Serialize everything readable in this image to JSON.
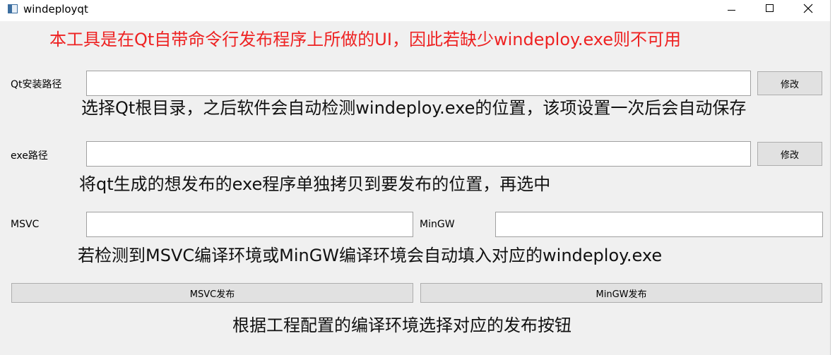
{
  "window": {
    "title": "windeployqt"
  },
  "heading": "本工具是在Qt自带命令行发布程序上所做的UI，因此若缺少windeploy.exe则不可用",
  "qt_path": {
    "label": "Qt安装路径",
    "value": "",
    "button": "修改",
    "hint": "选择Qt根目录，之后软件会自动检测windeploy.exe的位置，该项设置一次后会自动保存"
  },
  "exe_path": {
    "label": "exe路径",
    "value": "",
    "button": "修改",
    "hint": "将qt生成的想发布的exe程序单独拷贝到要发布的位置，再选中"
  },
  "compilers": {
    "msvc_label": "MSVC",
    "msvc_value": "",
    "mingw_label": "MinGW",
    "mingw_value": "",
    "hint": "若检测到MSVC编译环境或MinGW编译环境会自动填入对应的windeploy.exe"
  },
  "publish": {
    "msvc_button": "MSVC发布",
    "mingw_button": "MinGW发布",
    "hint": "根据工程配置的编译环境选择对应的发布按钮"
  },
  "icons": [
    "app-icon",
    "minimize-icon",
    "maximize-icon",
    "close-icon"
  ]
}
